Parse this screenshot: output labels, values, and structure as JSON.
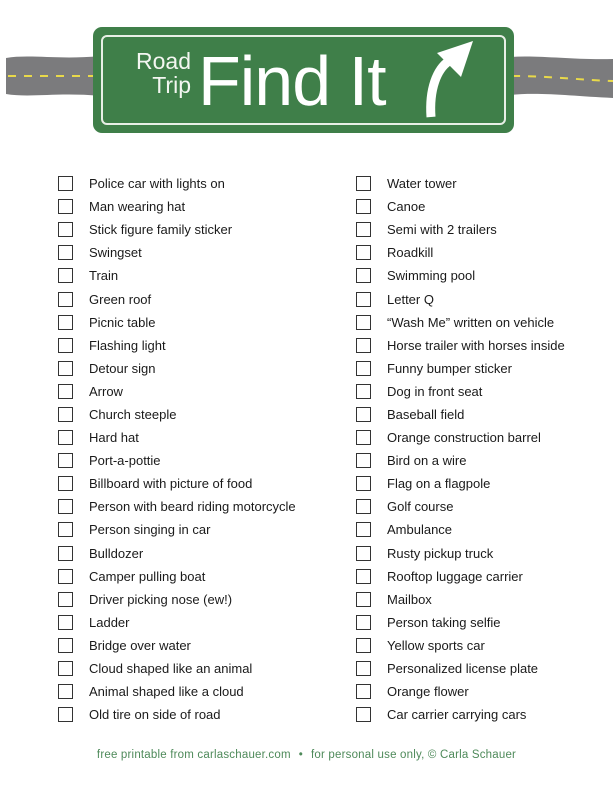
{
  "header": {
    "title_small_line1": "Road",
    "title_small_line2": "Trip",
    "title_big": "Find It",
    "icon": "curved-arrow-right-icon",
    "colors": {
      "sign_green": "#3f7f49",
      "road_gray": "#7b7b7d",
      "road_line_yellow": "#e8d94a"
    }
  },
  "checklist": {
    "left": [
      "Police car with lights on",
      "Man wearing hat",
      "Stick figure family sticker",
      "Swingset",
      "Train",
      "Green roof",
      "Picnic table",
      "Flashing light",
      "Detour sign",
      "Arrow",
      "Church steeple",
      "Hard hat",
      "Port-a-pottie",
      "Billboard with picture of food",
      "Person with beard riding motorcycle",
      "Person singing in car",
      "Bulldozer",
      "Camper pulling boat",
      "Driver picking nose (ew!)",
      "Ladder",
      "Bridge over water",
      "Cloud shaped like an animal",
      "Animal shaped like a cloud",
      "Old tire on side of road"
    ],
    "right": [
      "Water tower",
      "Canoe",
      "Semi with 2 trailers",
      "Roadkill",
      "Swimming pool",
      "Letter Q",
      "“Wash Me” written on vehicle",
      "Horse trailer with horses inside",
      "Funny bumper sticker",
      "Dog in front seat",
      "Baseball field",
      "Orange construction barrel",
      "Bird on a wire",
      "Flag on a flagpole",
      "Golf course",
      "Ambulance",
      "Rusty pickup truck",
      "Rooftop luggage carrier",
      "Mailbox",
      "Person taking selfie",
      "Yellow sports car",
      "Personalized license plate",
      "Orange flower",
      "Car carrier carrying cars"
    ]
  },
  "footer": {
    "left_text": "free printable from carlaschauer.com",
    "separator": "•",
    "right_text": "for personal use only, © Carla Schauer"
  }
}
